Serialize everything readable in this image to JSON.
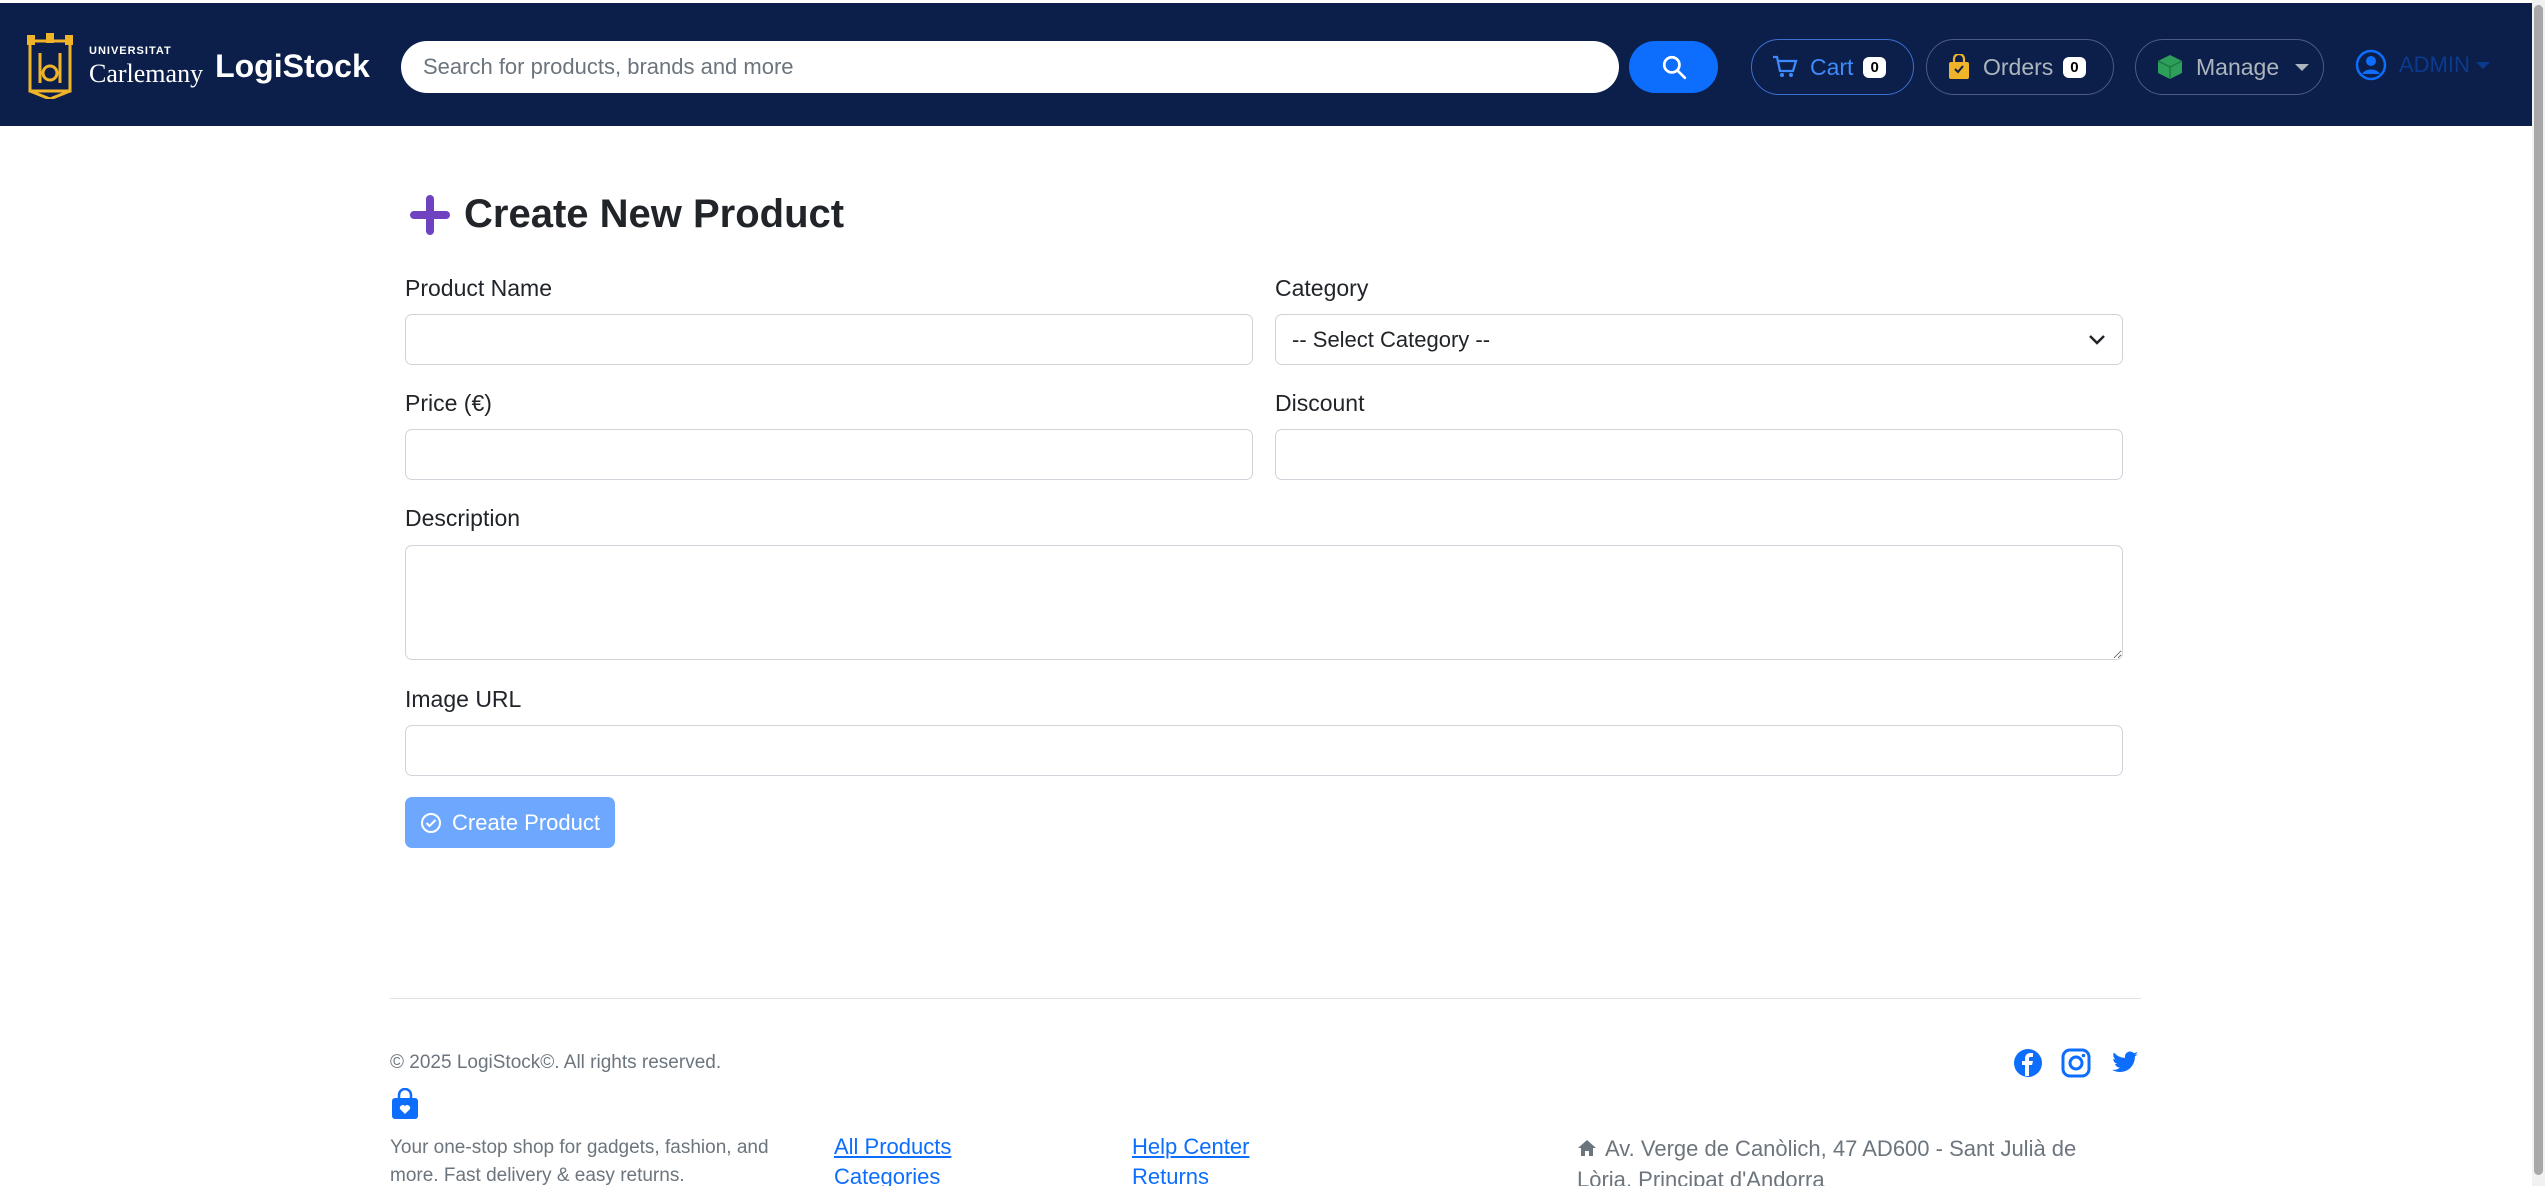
{
  "header": {
    "logo_small": "UNIVERSITAT",
    "logo_big": "Carlemany",
    "brand": "LogiStock",
    "search_placeholder": "Search for products, brands and more",
    "cart_label": "Cart",
    "cart_count": "0",
    "orders_label": "Orders",
    "orders_count": "0",
    "manage_label": "Manage",
    "user_label": "ADMIN"
  },
  "form": {
    "title": "Create New Product",
    "product_name_label": "Product Name",
    "category_label": "Category",
    "category_selected": "-- Select Category --",
    "price_label": "Price (€)",
    "discount_label": "Discount",
    "description_label": "Description",
    "image_url_label": "Image URL",
    "submit_label": "Create Product"
  },
  "footer": {
    "copyright": "© 2025 LogiStock©. All rights reserved.",
    "tagline": "Your one-stop shop for gadgets, fashion, and more. Fast delivery & easy returns.",
    "links_col1": [
      "All Products",
      "Categories"
    ],
    "links_col2": [
      "Help Center",
      "Returns"
    ],
    "address": "Av. Verge de Canòlich, 47 AD600 - Sant Julià de Lòria, Principat d'Andorra"
  },
  "colors": {
    "navbar": "#0b1f4a",
    "primary": "#0d6efd",
    "button_disabled": "#6ea8fe",
    "plus_icon": "#6f42c1"
  },
  "icons": [
    "crest-icon",
    "search-icon",
    "cart-icon",
    "bag-icon",
    "box-icon",
    "user-icon",
    "plus-icon",
    "check-circle-icon",
    "facebook-icon",
    "instagram-icon",
    "twitter-icon",
    "home-icon"
  ]
}
